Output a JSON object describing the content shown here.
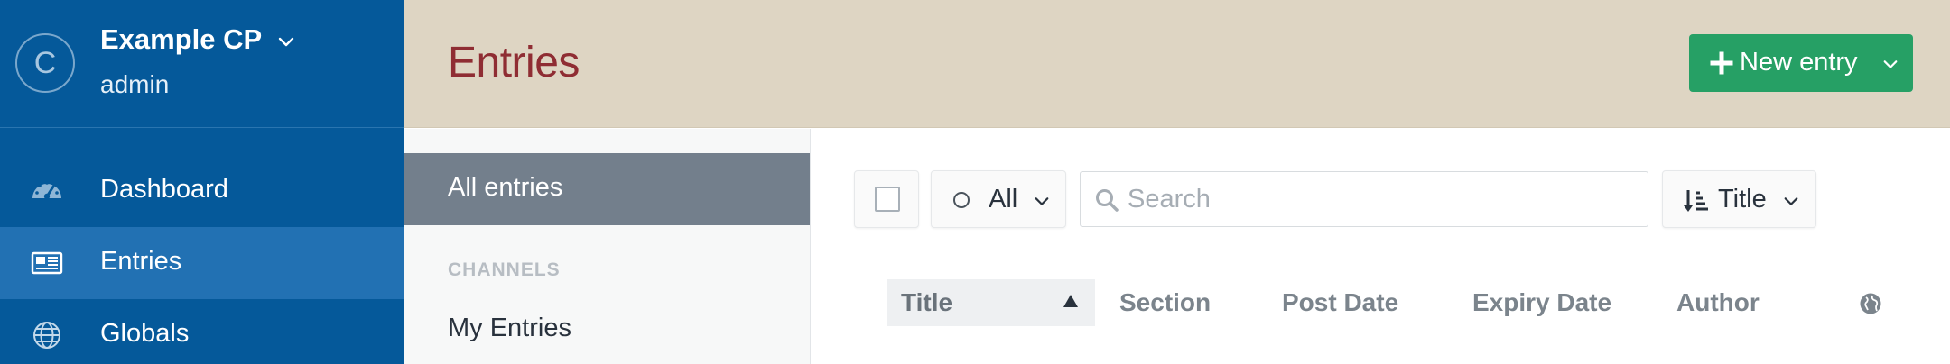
{
  "site": {
    "logo_letter": "C",
    "name": "Example CP",
    "user": "admin"
  },
  "nav": {
    "items": [
      {
        "label": "Dashboard",
        "icon": "gauge-icon",
        "active": false
      },
      {
        "label": "Entries",
        "icon": "newspaper-icon",
        "active": true
      },
      {
        "label": "Globals",
        "icon": "globe-icon",
        "active": false
      }
    ]
  },
  "header": {
    "title": "Entries",
    "new_entry_label": "New entry"
  },
  "sources": {
    "all_label": "All entries",
    "heading": "CHANNELS",
    "items": [
      "My Entries"
    ]
  },
  "toolbar": {
    "status_label": "All",
    "search_placeholder": "Search",
    "sort_label": "Title"
  },
  "table": {
    "columns": [
      "Title",
      "Section",
      "Post Date",
      "Expiry Date",
      "Author"
    ],
    "sorted_column": "Title",
    "sort_direction": "ascending"
  },
  "colors": {
    "sidebar": "#05599a",
    "sidebar_active": "#2271b3",
    "header_bg": "#ded5c3",
    "title_red": "#8f2d33",
    "button_green": "#26a065",
    "source_selected": "#737f8c"
  }
}
